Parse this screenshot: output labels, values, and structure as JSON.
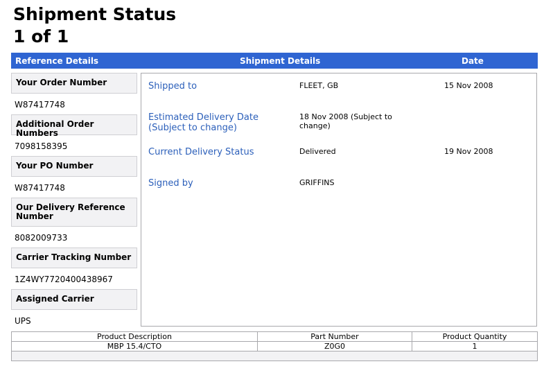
{
  "page": {
    "title_line1": "Shipment Status",
    "title_line2": "1 of 1"
  },
  "header": {
    "reference": "Reference Details",
    "shipment": "Shipment Details",
    "date": "Date"
  },
  "reference": [
    {
      "label": "Your Order Number",
      "value": "W87417748"
    },
    {
      "label": "Additional Order Numbers",
      "value": "7098158395"
    },
    {
      "label": "Your PO Number",
      "value": "W87417748"
    },
    {
      "label": "Our Delivery Reference Number",
      "value": "8082009733"
    },
    {
      "label": "Carrier Tracking Number",
      "value": "1Z4WY7720400438967"
    },
    {
      "label": "Assigned Carrier",
      "value": "UPS"
    }
  ],
  "shipment": [
    {
      "label": "Shipped to",
      "value": "FLEET, GB",
      "date": "15 Nov 2008"
    },
    {
      "label": "Estimated Delivery Date (Subject to change)",
      "value": "18 Nov 2008 (Subject to change)",
      "date": ""
    },
    {
      "label": "Current Delivery Status",
      "value": "Delivered",
      "date": "19 Nov 2008"
    },
    {
      "label": "Signed by",
      "value": "GRIFFINS",
      "date": ""
    }
  ],
  "products": {
    "columns": [
      "Product Description",
      "Part Number",
      "Product Quantity"
    ],
    "rows": [
      [
        "MBP 15.4/CTO",
        "Z0G0",
        "1"
      ]
    ]
  }
}
